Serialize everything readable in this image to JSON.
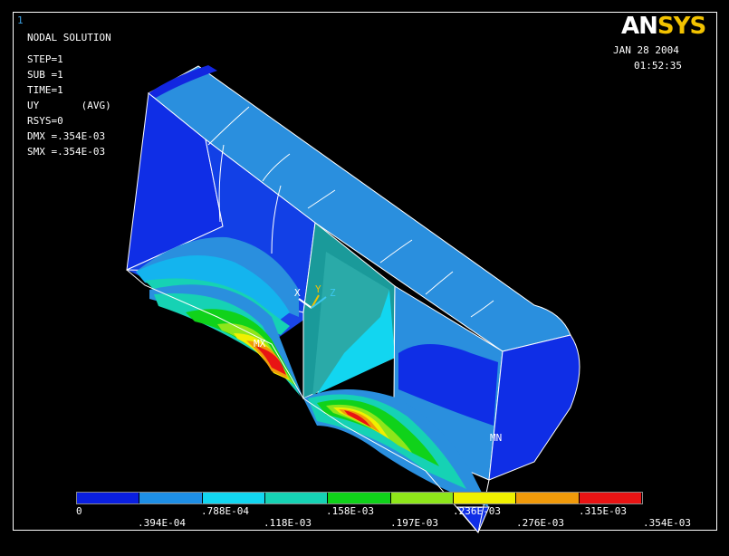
{
  "window_number": "1",
  "header": {
    "title": "NODAL SOLUTION",
    "lines": [
      "STEP=1",
      "SUB =1",
      "TIME=1",
      "UY       (AVG)",
      "RSYS=0",
      "DMX =.354E-03",
      "SMX =.354E-03"
    ]
  },
  "logo": {
    "part1": "AN",
    "part2": "SYS"
  },
  "date": "JAN 28 2004",
  "time": "01:52:35",
  "markers": {
    "max": "MX",
    "min": "MN"
  },
  "triad": {
    "x": "X",
    "y": "Y",
    "z": "Z"
  },
  "colors": {
    "accent_yellow": "#f2c200",
    "contour": [
      "#0a1fe0",
      "#1e8fe6",
      "#12d6f0",
      "#16d2b4",
      "#10d21a",
      "#8ee61a",
      "#f0f000",
      "#f09a0a",
      "#e81414"
    ]
  },
  "legend": {
    "top_labels": [
      "0",
      ".788E-04",
      ".158E-03",
      ".236E-03",
      ".315E-03"
    ],
    "bottom_labels": [
      ".394E-04",
      ".118E-03",
      ".197E-03",
      ".276E-03",
      ".354E-03"
    ]
  }
}
